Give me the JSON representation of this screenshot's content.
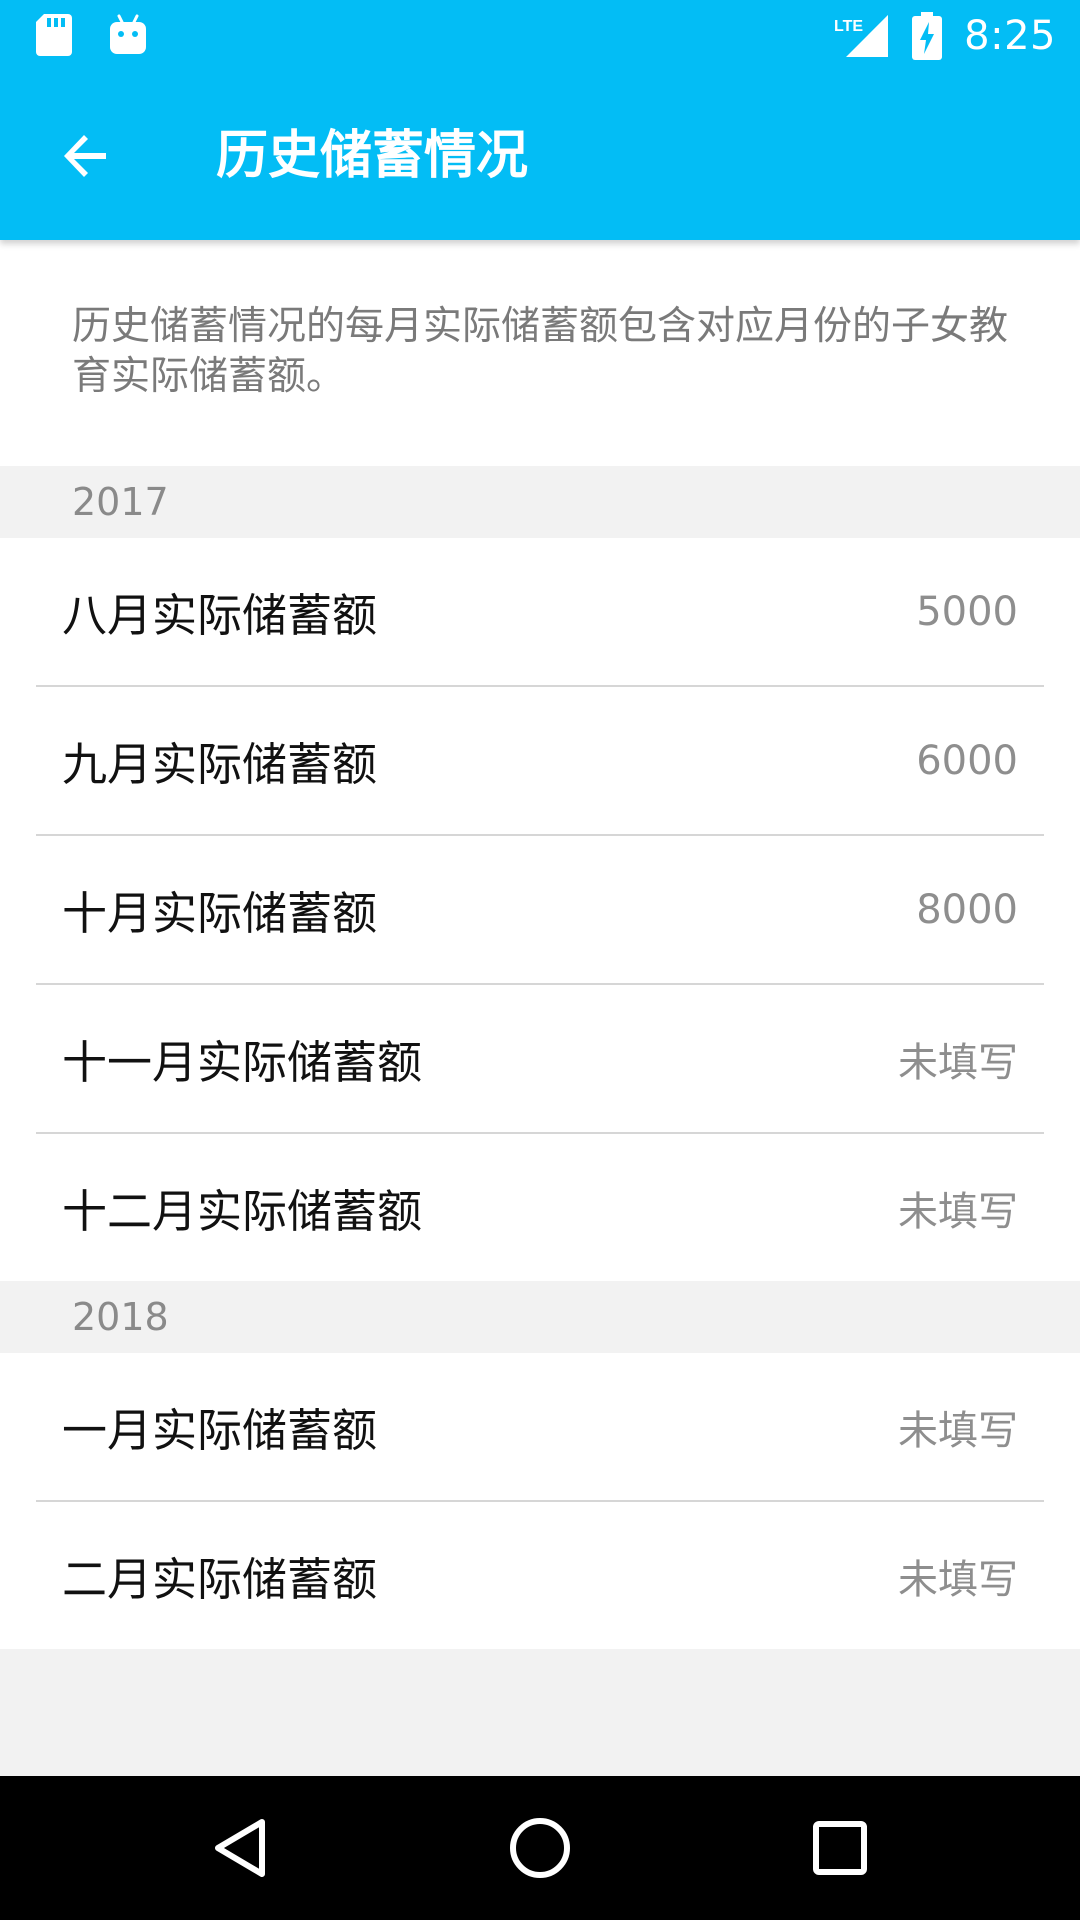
{
  "status_bar": {
    "time": "8:25",
    "icons": [
      "sd-card-icon",
      "android-icon",
      "lte-signal-icon",
      "battery-charging-icon"
    ],
    "network_label": "LTE"
  },
  "toolbar": {
    "back_icon": "arrow-back-icon",
    "title": "历史储蓄情况"
  },
  "intro_text": "历史储蓄情况的每月实际储蓄额包含对应月份的子女教育实际储蓄额。",
  "sections": [
    {
      "year": "2017",
      "items": [
        {
          "label": "八月实际储蓄额",
          "value": "5000"
        },
        {
          "label": "九月实际储蓄额",
          "value": "6000"
        },
        {
          "label": "十月实际储蓄额",
          "value": "8000"
        },
        {
          "label": "十一月实际储蓄额",
          "value": "未填写"
        },
        {
          "label": "十二月实际储蓄额",
          "value": "未填写"
        }
      ]
    },
    {
      "year": "2018",
      "items": [
        {
          "label": "一月实际储蓄额",
          "value": "未填写"
        },
        {
          "label": "二月实际储蓄额",
          "value": "未填写"
        }
      ]
    }
  ],
  "nav_bar": {
    "buttons": [
      "back-triangle-icon",
      "home-circle-icon",
      "recents-square-icon"
    ]
  },
  "colors": {
    "primary": "#03bdf5",
    "background": "#f2f2f2",
    "surface": "#ffffff",
    "divider": "#d6d6d6",
    "secondary_text": "#8e8e8e"
  }
}
